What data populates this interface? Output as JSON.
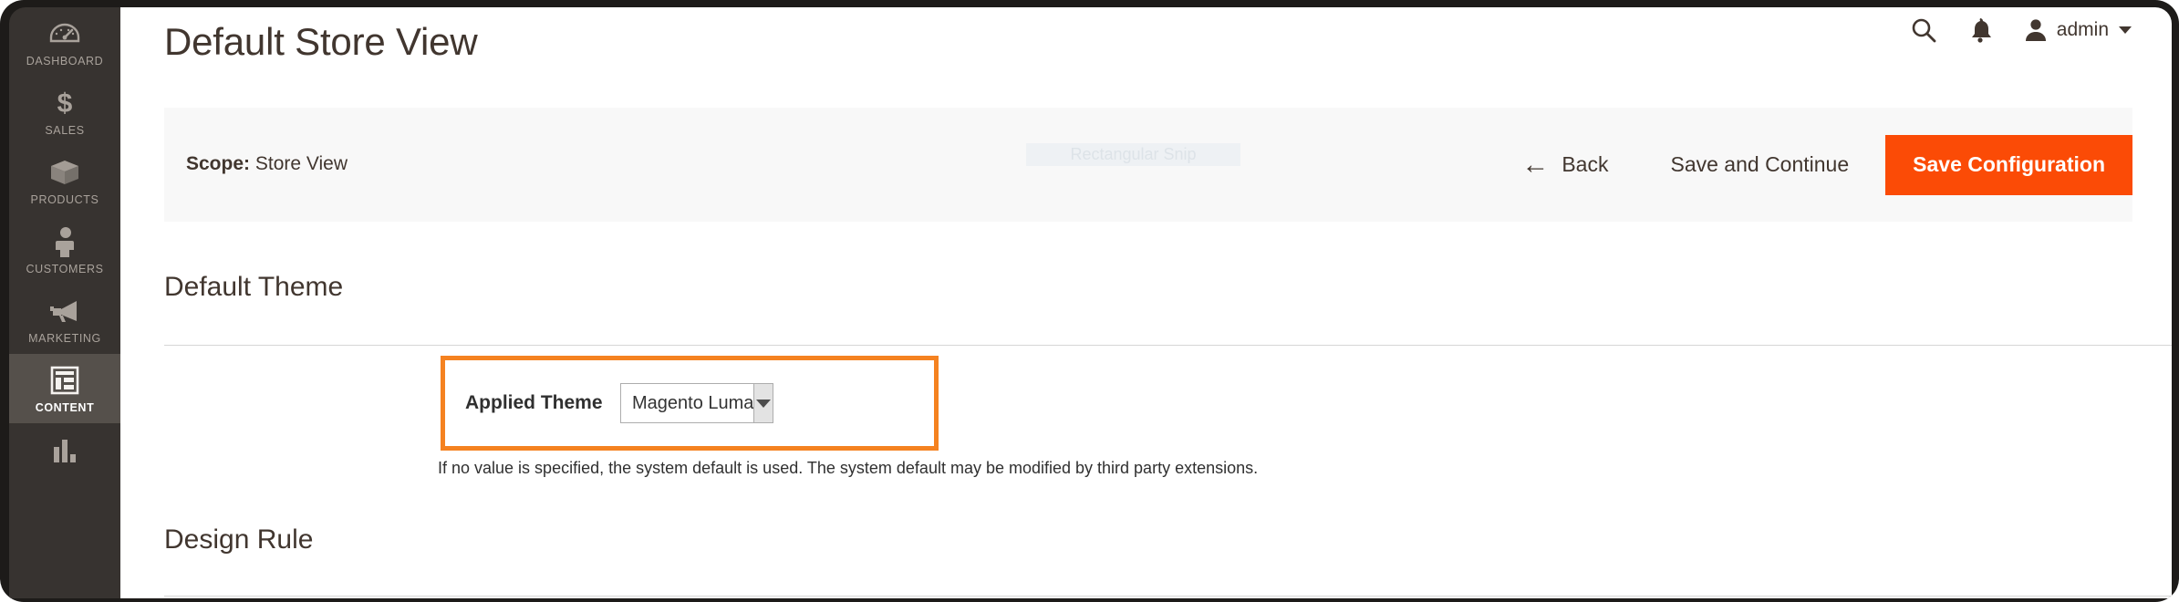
{
  "sidebar": {
    "items": [
      {
        "label": "DASHBOARD",
        "icon": "dashboard-gauge-icon",
        "active": false
      },
      {
        "label": "SALES",
        "icon": "dollar-sign-icon",
        "active": false
      },
      {
        "label": "PRODUCTS",
        "icon": "box-icon",
        "active": false
      },
      {
        "label": "CUSTOMERS",
        "icon": "person-icon",
        "active": false
      },
      {
        "label": "MARKETING",
        "icon": "megaphone-icon",
        "active": false
      },
      {
        "label": "CONTENT",
        "icon": "layout-panel-icon",
        "active": true
      },
      {
        "label": "",
        "icon": "bar-chart-icon",
        "active": false
      }
    ]
  },
  "header": {
    "title": "Default Store View",
    "search_icon": "search-icon",
    "notification_icon": "bell-icon",
    "avatar_icon": "user-avatar-icon",
    "admin_label": "admin",
    "caret_icon": "chevron-down-icon"
  },
  "scopebar": {
    "scope_label": "Scope:",
    "scope_value": "Store View",
    "watermark": "Rectangular Snip",
    "back_label": "Back",
    "back_icon": "arrow-left-icon",
    "save_continue_label": "Save and Continue",
    "save_config_label": "Save Configuration",
    "primary_color": "#fb4b06"
  },
  "sections": {
    "default_theme_title": "Default Theme",
    "design_rule_title": "Design Rule"
  },
  "applied_theme": {
    "label": "Applied Theme",
    "value": "Magento Luma",
    "dropdown_icon": "triangle-down-icon",
    "note": "If no value is specified, the system default is used. The system default may be modified by third party extensions.",
    "highlight_color": "#f58220"
  }
}
